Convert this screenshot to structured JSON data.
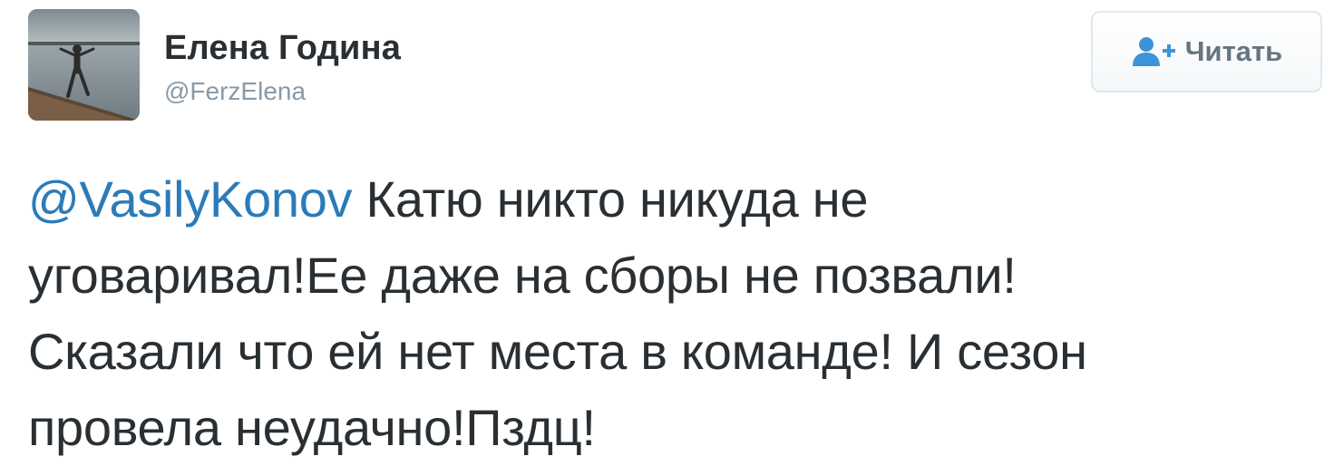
{
  "author": {
    "name": "Елена Година",
    "handle": "@FerzElena"
  },
  "follow_button": {
    "icon": "follow-person-plus-icon",
    "label": "Читать"
  },
  "tweet": {
    "mention": "@VasilyKonov",
    "line1_rest": " Катю никто никуда не",
    "line2": "уговаривал!Ее даже на сборы не позвали!",
    "line3": "Сказали что ей нет места в команде! И сезон",
    "line4": "провела неудачно!Пздц!"
  },
  "colors": {
    "text": "#292f33",
    "mention": "#2b7bb9",
    "handle": "#8899a6",
    "follow_icon": "#3b94d9",
    "button_border": "#e1e8ed"
  }
}
